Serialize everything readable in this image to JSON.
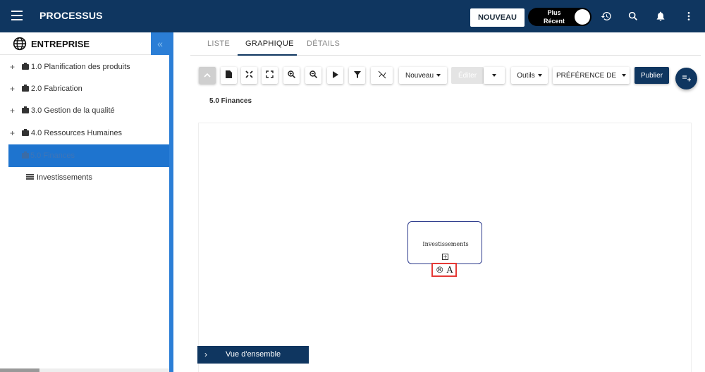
{
  "topbar": {
    "title": "PROCESSUS",
    "new_button": "NOUVEAU",
    "toggle_label": "Plus Récent",
    "icons": [
      "menu-icon",
      "history-icon",
      "search-icon",
      "bell-icon",
      "more-vertical-icon"
    ]
  },
  "sidebar": {
    "title": "ENTREPRISE",
    "collapse_glyph": "«",
    "items": [
      {
        "label": "1.0 Planification des produits",
        "expand": "+",
        "selected": false
      },
      {
        "label": "2.0 Fabrication",
        "expand": "+",
        "selected": false
      },
      {
        "label": "3.0 Gestion de la qualité",
        "expand": "+",
        "selected": false
      },
      {
        "label": "4.0 Ressources Humaines",
        "expand": "+",
        "selected": false
      },
      {
        "label": "5.0 Finances",
        "expand": "",
        "selected": true
      },
      {
        "label": "Investissements",
        "expand": "",
        "selected": false
      }
    ]
  },
  "tabs": [
    {
      "label": "LISTE",
      "active": false
    },
    {
      "label": "GRAPHIQUE",
      "active": true
    },
    {
      "label": "DÉTAILS",
      "active": false
    }
  ],
  "toolbar": {
    "nouveau_label": "Nouveau",
    "editer_label": "Éditer",
    "outils_label": "Outils",
    "preference_label": "PRÉFÉRENCE DE",
    "publier_label": "Publier"
  },
  "breadcrumb": "5.0 Finances",
  "diagram": {
    "node_label": "Investissements",
    "node_expand": "⊞",
    "raci_label": "® A"
  },
  "overview": {
    "label": "Vue d'ensemble"
  },
  "colors": {
    "topbar": "#0f3660",
    "sidebar_accent": "#2b7ed6",
    "selected_item": "#1e74cf",
    "highlight_box": "#e53935"
  }
}
